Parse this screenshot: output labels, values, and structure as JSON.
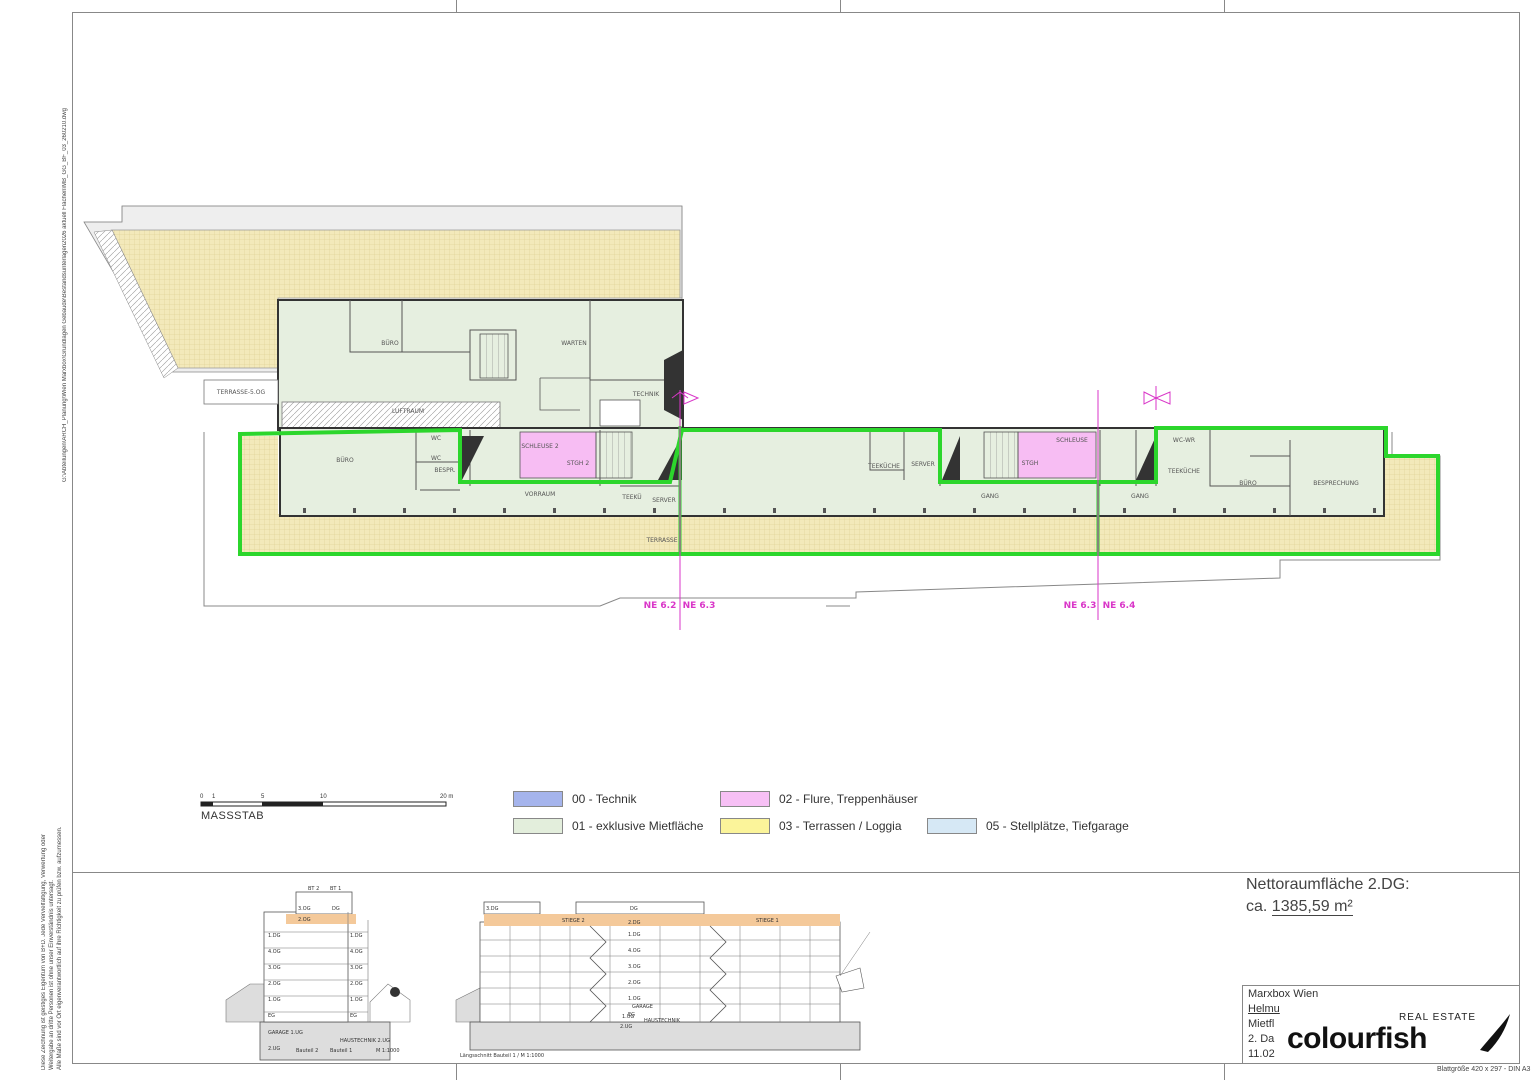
{
  "file_path": "G:\\Abteilungen\\ARCH_Planung\\Wien Marxbox\\Grundlagen Gebäude\\Bestandsunterlagen2026 aktuell Flächen\\MB_GG_BF_03_260210.dwg",
  "disclaimer": [
    "Diese Zeichnung ist geistiges Eigentum von B+D. Jede Vervielfältigung, Verwertung oder",
    "Weitergabe an dritte Personen ist ohne unser Einverständnis untersagt.",
    "Alle Maße sind vor Ort eigenverantwortlich auf ihre Richtigkeit zu prüfen bzw. aufzumessen."
  ],
  "plan": {
    "rooms": {
      "buero_top": "BÜRO",
      "warten": "WARTEN",
      "technik": "TECHNIK",
      "terrasse_5og": "TERRASSE-5.OG",
      "luftraum": "LUFTRAUM",
      "buero_left": "BÜRO",
      "wc1": "WC",
      "wc2": "WC",
      "bespr": "BESPR.",
      "schleuse2": "SCHLEUSE 2",
      "stgh2": "STGH 2",
      "vorraum": "VORRAUM",
      "teekueche_left": "TEEKÜ",
      "server_left": "SERVER",
      "terrasse": "TERRASSE",
      "teekueche_mid": "TEEKÜCHE",
      "server_mid": "SERVER",
      "stgh": "STGH",
      "schleuse": "SCHLEUSE",
      "gang_mid": "GANG",
      "gang_right": "GANG",
      "wc_wr": "WC-WR",
      "teekueche_right": "TEEKÜCHE",
      "buero_right": "BÜRO",
      "besprechung": "BESPRECHUNG"
    },
    "ne_markers": [
      {
        "left": "NE 6.2",
        "right": "NE 6.3"
      },
      {
        "left": "NE 6.3",
        "right": "NE 6.4"
      }
    ]
  },
  "scale_bar": {
    "ticks": [
      "0",
      "1",
      "5",
      "10",
      "20 m"
    ],
    "label": "MASSSTAB"
  },
  "legend": [
    {
      "label": "00 - Technik",
      "color": "#a5b4ec"
    },
    {
      "label": "02 - Flure, Treppenhäuser",
      "color": "#f7c0f5"
    },
    {
      "label": "01 - exklusive Mietfläche",
      "color": "#e3eedc"
    },
    {
      "label": "03 - Terrassen / Loggia",
      "color": "#fbf49a"
    },
    {
      "label": "05 - Stellplätze, Tiefgarage",
      "color": "#d6e8f5"
    }
  ],
  "colors": {
    "rent": "#e6efe0",
    "terrace": "#f2e8b8",
    "stairs": "#f7bdf3",
    "outline": "#2cd62c",
    "marker": "#d936c8"
  },
  "section_left": {
    "bt2": "BT 2",
    "bt1": "BT 1",
    "floors_left": [
      "3.OG",
      "2.OG",
      "1.DG",
      "4.OG",
      "3.OG",
      "2.OG",
      "1.OG",
      "EG",
      "GARAGE 1.UG",
      "2.UG"
    ],
    "floors_right": [
      "DG",
      "1.DG",
      "4.OG",
      "3.OG",
      "2.OG",
      "1.OG",
      "EG",
      "HAUSTECHNIK 2.UG"
    ],
    "caption_a": "Bauteil 2",
    "caption_b": "Bauteil 1",
    "scale": "M 1:1000"
  },
  "section_long": {
    "top_left": "3.DG",
    "top_mid": "DG",
    "stiege2": "STIEGE 2",
    "stiege1": "STIEGE 1",
    "floors": [
      "2.DG",
      "1.DG",
      "4.OG",
      "3.OG",
      "2.OG",
      "1.OG",
      "EG",
      "GARAGE",
      "1.UG",
      "HAUSTECHNIK",
      "2.UG"
    ],
    "caption": "Längsschnitt Bauteil 1 / M 1:1000"
  },
  "net_area": {
    "title": "Nettoraumfläche 2.DG:",
    "prefix": "ca.",
    "value": "1385,59 m²"
  },
  "title_block": {
    "line1": "Marxbox Wien",
    "line2": "Helmu",
    "line3": "Mietfl",
    "line4": "2. Da",
    "line5": "11.02"
  },
  "brand": {
    "tagline": "REAL ESTATE",
    "name": "colourfish"
  },
  "sheet_size": "Blattgröße 420 x 297 - DIN A3"
}
